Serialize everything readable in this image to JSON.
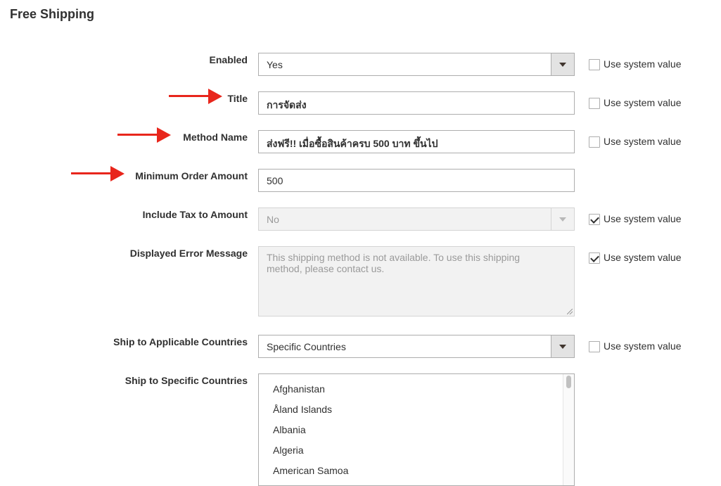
{
  "section": {
    "title": "Free Shipping"
  },
  "use_system_value_label": "Use system value",
  "fields": {
    "enabled": {
      "label": "Enabled",
      "value": "Yes",
      "use_system": false
    },
    "title": {
      "label": "Title",
      "value": "การจัดส่ง",
      "use_system": false
    },
    "method_name": {
      "label": "Method Name",
      "value": "ส่งฟรี!! เมื่อซื้อสินค้าครบ 500 บาท ขึ้นไป",
      "use_system": false
    },
    "min_order": {
      "label": "Minimum Order Amount",
      "value": "500"
    },
    "include_tax": {
      "label": "Include Tax to Amount",
      "value": "No",
      "use_system": true
    },
    "error_message": {
      "label": "Displayed Error Message",
      "value": "This shipping method is not available. To use this shipping method, please contact us.",
      "use_system": true
    },
    "applicable_countries": {
      "label": "Ship to Applicable Countries",
      "value": "Specific Countries",
      "use_system": false
    },
    "specific_countries": {
      "label": "Ship to Specific Countries",
      "options": [
        "Afghanistan",
        "Åland Islands",
        "Albania",
        "Algeria",
        "American Samoa"
      ]
    }
  },
  "annotations": {
    "arrow_color": "#e8261c"
  }
}
